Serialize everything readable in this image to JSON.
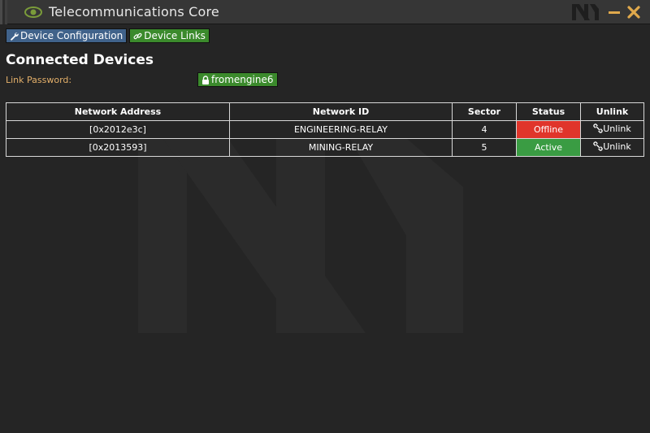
{
  "window": {
    "title": "Telecommunications Core",
    "accent": "#7a9b3a"
  },
  "tabs": [
    {
      "label": "Device Configuration",
      "icon": "wrench-icon",
      "color": "#40628a"
    },
    {
      "label": "Device Links",
      "icon": "link-icon",
      "color": "#3b8a2c"
    }
  ],
  "main": {
    "heading": "Connected Devices",
    "password_label": "Link Password:",
    "password_value": "fromengine6",
    "password_icon": "lock-icon"
  },
  "table": {
    "headers": [
      "Network Address",
      "Network ID",
      "Sector",
      "Status",
      "Unlink"
    ],
    "rows": [
      {
        "address": "[0x2012e3c]",
        "id": "ENGINEERING-RELAY",
        "sector": "4",
        "status": "Offline",
        "status_color": "#e0352b",
        "unlink": "Unlink"
      },
      {
        "address": "[0x2013593]",
        "id": "MINING-RELAY",
        "sector": "5",
        "status": "Active",
        "status_color": "#3a9c43",
        "unlink": "Unlink"
      }
    ]
  }
}
